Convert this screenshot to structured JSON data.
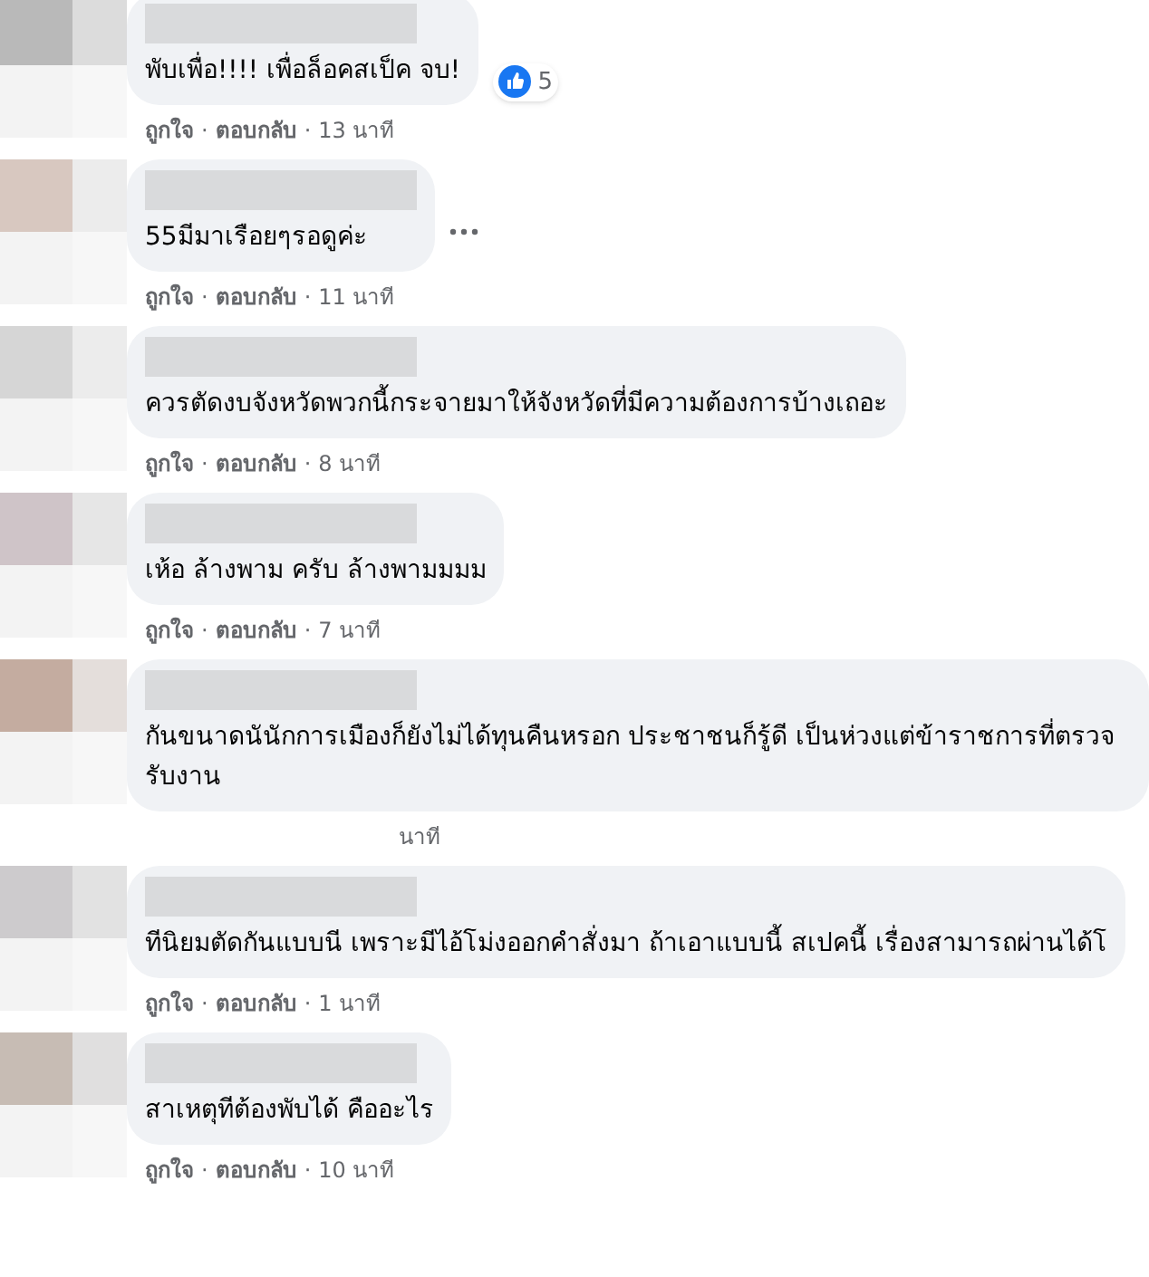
{
  "comments": [
    {
      "text": "พับเพื่อ!!!! เพื่อล็อคสเป็ค จบ!",
      "reaction": {
        "count": "5"
      },
      "more_options": false,
      "meta": {
        "like": "ถูกใจ",
        "sep_1": "·",
        "reply": "ตอบกลับ",
        "sep_2": "·",
        "time": "13 นาที"
      }
    },
    {
      "text": "55มีมาเรือยๆรอดูค่ะ",
      "more_options": true,
      "meta": {
        "like": "ถูกใจ",
        "sep_1": "·",
        "reply": "ตอบกลับ",
        "sep_2": "·",
        "time": "11 นาที"
      }
    },
    {
      "text": "ควรตัดงบจังหวัดพวกนี้กระจายมาให้จังหวัดที่มีความต้องการบ้างเถอะ",
      "more_options": false,
      "meta": {
        "like": "ถูกใจ",
        "sep_1": "·",
        "reply": "ตอบกลับ",
        "sep_2": "·",
        "time": "8 นาที"
      }
    },
    {
      "text": "เห้อ ล้างพาม ครับ ล้างพามมมม",
      "more_options": false,
      "meta": {
        "like": "ถูกใจ",
        "sep_1": "·",
        "reply": "ตอบกลับ",
        "sep_2": "·",
        "time": "7 นาที"
      }
    },
    {
      "text": "กันขนาดนันักการเมืองก็ยังไม่ได้ทุนคืนหรอก ประชาชนก็รู้ดี เป็นห่วงแต่ข้าราชการที่ตรวจรับงาน",
      "more_options": false,
      "meta": {
        "time": "นาที"
      }
    },
    {
      "text": "ทีนิยมตัดกันแบบนี เพราะมีไอ้โม่งออกคำสั่งมา ถ้าเอาแบบนี้ สเปคนี้ เรื่องสามารถผ่านได้โ",
      "more_options": false,
      "meta": {
        "like": "ถูกใจ",
        "sep_1": "·",
        "reply": "ตอบกลับ",
        "sep_2": "·",
        "time": "1 นาที"
      }
    },
    {
      "text": "สาเหตุทีต้องพับได้ คืออะไร",
      "more_options": false,
      "meta": {
        "like": "ถูกใจ",
        "sep_1": "·",
        "reply": "ตอบกลับ",
        "sep_2": "·",
        "time": "10 นาที"
      }
    }
  ]
}
